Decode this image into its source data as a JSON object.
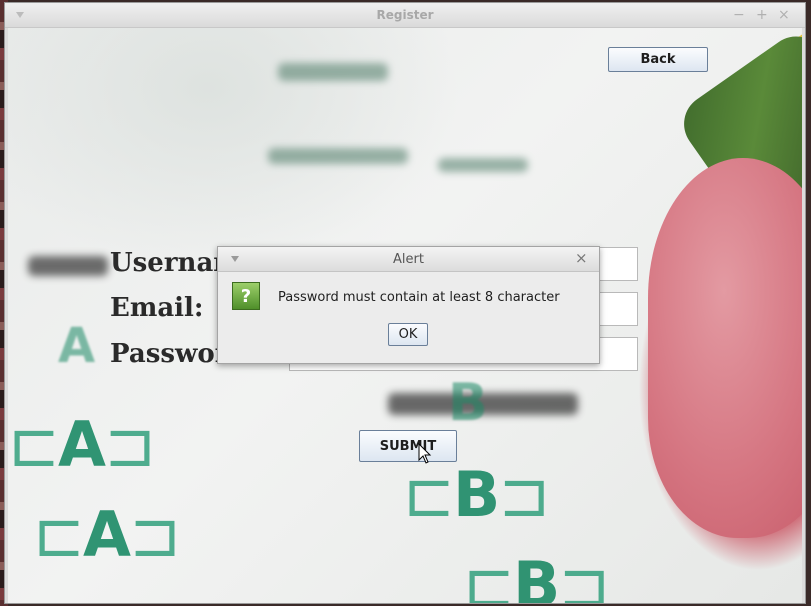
{
  "window": {
    "title": "Register"
  },
  "back_button": "Back",
  "form": {
    "username_label": "Username:",
    "email_label": "Email:",
    "password_label": "Password:",
    "submit_label": "SUBMIT"
  },
  "dialog": {
    "title": "Alert",
    "message": "Password must contain at least 8 character",
    "ok_label": "OK",
    "icon": "question-icon"
  },
  "colors": {
    "accent_green": "#1c8a66",
    "button_border": "#6a7f99"
  }
}
